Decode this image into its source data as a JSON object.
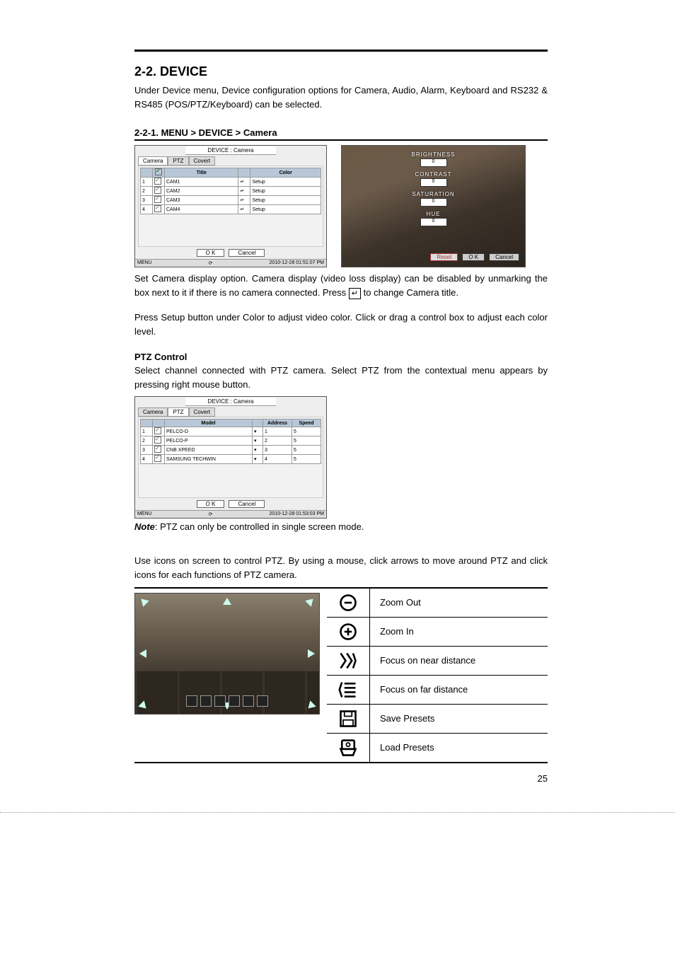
{
  "doc": {
    "section_title": "2-2. DEVICE",
    "intro_p1": "Under Device menu, Device configuration options for Camera, Audio, Alarm, Keyboard and RS232 & RS485 (POS/PTZ/Keyboard) can be selected.",
    "sub1_title": "2-2-1. MENU > DEVICE > Camera",
    "camera_p1_a": "Set Camera display option. Camera display (video loss display) can be disabled by unmarking the box next to it if there is no camera connected. Press ",
    "camera_p1_b": " to change Camera title.",
    "enter_glyph": "↵",
    "camera_p2": "Press Setup button under Color to adjust video color. Click or drag a control box to adjust each color level.",
    "ptz_heading": "PTZ Control",
    "ptz_p1": "Select channel connected with PTZ camera. Select PTZ from the contextual menu appears by pressing right mouse button.",
    "note_label": "Note",
    "note_text": ": PTZ can only be controlled in single screen mode.",
    "use_icons_p": "Use icons on screen to control PTZ. By using a mouse, click arrows to move around PTZ and click icons for each functions of PTZ camera.",
    "page_number": "25"
  },
  "dialog1": {
    "breadcrumb": "DEVICE : Camera",
    "tabs": [
      "Camera",
      "PTZ",
      "Covert"
    ],
    "columns": [
      "",
      "",
      "Title",
      "",
      "Color"
    ],
    "rows": [
      {
        "n": "1",
        "title": "CAM1",
        "color": "Setup"
      },
      {
        "n": "2",
        "title": "CAM2",
        "color": "Setup"
      },
      {
        "n": "3",
        "title": "CAM3",
        "color": "Setup"
      },
      {
        "n": "4",
        "title": "CAM4",
        "color": "Setup"
      }
    ],
    "ok": "O K",
    "cancel": "Cancel",
    "menu": "MENU",
    "status_mid": "",
    "status_time": "2010-12-28 01:51:07 PM"
  },
  "colorpanel": {
    "brightness": "BRIGHTNESS",
    "contrast": "CONTRAST",
    "saturation": "SATURATION",
    "hue": "HUE",
    "val": "0",
    "reset": "Reset",
    "ok": "O K",
    "cancel": "Cancel"
  },
  "dialog2": {
    "breadcrumb": "DEVICE : Camera",
    "tabs": [
      "Camera",
      "PTZ",
      "Covert"
    ],
    "columns": [
      "",
      "",
      "Model",
      "",
      "Address",
      "Speed"
    ],
    "rows": [
      {
        "n": "1",
        "model": "PELCO-D",
        "addr": "1",
        "speed": "5"
      },
      {
        "n": "2",
        "model": "PELCO-P",
        "addr": "2",
        "speed": "5"
      },
      {
        "n": "3",
        "model": "CNB XPEED",
        "addr": "3",
        "speed": "5"
      },
      {
        "n": "4",
        "model": "SAMSUNG TECHWIN",
        "addr": "4",
        "speed": "5"
      }
    ],
    "ok": "O K",
    "cancel": "Cancel",
    "menu": "MENU",
    "status_time": "2010-12-28 01:53:03 PM"
  },
  "icons": {
    "zoom_out": "Zoom Out",
    "zoom_in": "Zoom In",
    "focus_near": "Focus on near distance",
    "focus_far": "Focus on far distance",
    "save_presets": "Save Presets",
    "load_presets": "Load Presets"
  }
}
